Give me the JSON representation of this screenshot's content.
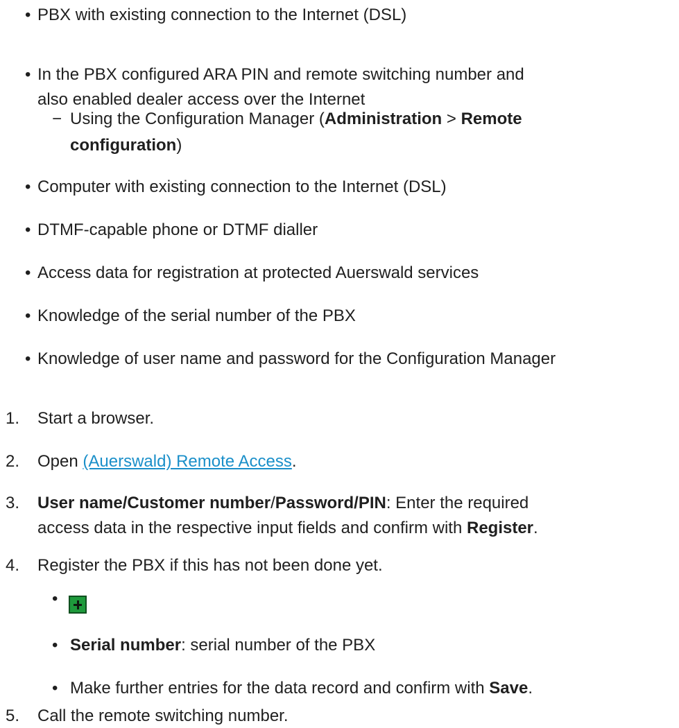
{
  "requirements": {
    "items": [
      "PBX with existing connection to the Internet (DSL)",
      "In the PBX configured ARA PIN and remote switching number and",
      "also enabled dealer access over the Internet",
      "Computer with existing connection to the Internet (DSL)",
      "DTMF-capable phone or DTMF dialler",
      "Access data for registration at protected Auerswald services",
      "Knowledge of the serial number of the PBX",
      "Knowledge of user name and password for the Configuration Manager"
    ],
    "sub": {
      "prefix": "Using the Configuration Manager (",
      "menu1": "Administration",
      "sep": " > ",
      "menu2": "Remote",
      "menu2_cont": "configuration",
      "suffix": ")"
    }
  },
  "steps": {
    "s1": {
      "num": "1.",
      "text": "Start a browser."
    },
    "s2": {
      "num": "2.",
      "prefix": "Open ",
      "link": "(Auerswald) Remote Access",
      "suffix": "."
    },
    "s3": {
      "num": "3.",
      "field1": "User name/Customer number",
      "slash": "/",
      "field2": "Password/PIN",
      "text": ": Enter the required",
      "line2": "access data in the respective input fields and confirm with ",
      "button": "Register",
      "end": "."
    },
    "s4": {
      "num": "4.",
      "text": "Register the PBX if this has not been done yet.",
      "add_icon": "plus-icon",
      "serial_label": "Serial number",
      "serial_text": ": serial number of the PBX",
      "further_text": "Make further entries for the data record and confirm with ",
      "save_button": "Save",
      "end": "."
    },
    "s5": {
      "num": "5.",
      "text": "Call the remote switching number."
    }
  },
  "glyphs": {
    "bullet": "•",
    "dash": "−"
  }
}
